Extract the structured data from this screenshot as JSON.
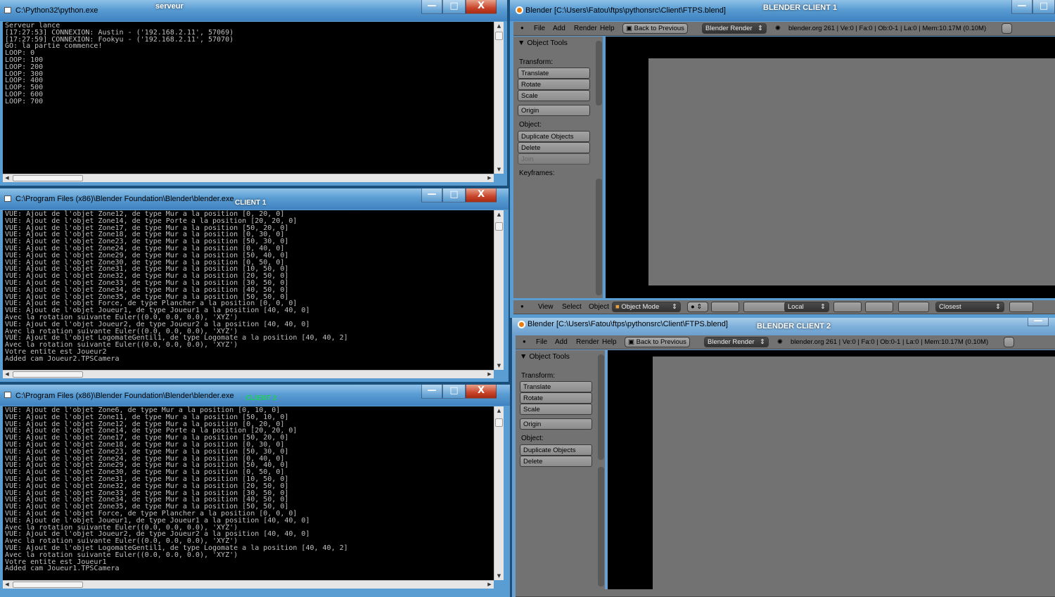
{
  "server_window": {
    "title": "C:\\Python32\\python.exe",
    "label": "serveur",
    "minimize": "—",
    "maximize": "□",
    "close": "X",
    "lines": [
      "Serveur lance",
      "[17:27:53] CONNEXION: Austin - ('192.168.2.11', 57069)",
      "[17:27:59] CONNEXION: Fookyu - ('192.168.2.11', 57070)",
      "GO: la partie commence!",
      "LOOP: 0",
      "LOOP: 100",
      "LOOP: 200",
      "LOOP: 300",
      "LOOP: 400",
      "LOOP: 500",
      "LOOP: 600",
      "LOOP: 700"
    ]
  },
  "client1_console": {
    "title": "C:\\Program Files (x86)\\Blender Foundation\\Blender\\blender.exe",
    "label": "CLIENT 1",
    "minimize": "—",
    "maximize": "□",
    "close": "X",
    "lines": [
      "VUE: Ajout de l'objet Zone12, de type Mur a la position [0, 20, 0]",
      "VUE: Ajout de l'objet Zone14, de type Porte a la position [20, 20, 0]",
      "VUE: Ajout de l'objet Zone17, de type Mur a la position [50, 20, 0]",
      "VUE: Ajout de l'objet Zone18, de type Mur a la position [0, 30, 0]",
      "VUE: Ajout de l'objet Zone23, de type Mur a la position [50, 30, 0]",
      "VUE: Ajout de l'objet Zone24, de type Mur a la position [0, 40, 0]",
      "VUE: Ajout de l'objet Zone29, de type Mur a la position [50, 40, 0]",
      "VUE: Ajout de l'objet Zone30, de type Mur a la position [0, 50, 0]",
      "VUE: Ajout de l'objet Zone31, de type Mur a la position [10, 50, 0]",
      "VUE: Ajout de l'objet Zone32, de type Mur a la position [20, 50, 0]",
      "VUE: Ajout de l'objet Zone33, de type Mur a la position [30, 50, 0]",
      "VUE: Ajout de l'objet Zone34, de type Mur a la position [40, 50, 0]",
      "VUE: Ajout de l'objet Zone35, de type Mur a la position [50, 50, 0]",
      "VUE: Ajout de l'objet Force, de type Plancher a la position [0, 0, 0]",
      "VUE: Ajout de l'objet Joueur1, de type Joueur1 a la position [40, 40, 0]",
      "Avec la rotation suivante Euler((0.0, 0.0, 0.0), 'XYZ')",
      "VUE: Ajout de l'objet Joueur2, de type Joueur2 a la position [40, 40, 0]",
      "Avec la rotation suivante Euler((0.0, 0.0, 0.0), 'XYZ')",
      "VUE: Ajout de l'objet LogomateGentil1, de type Logomate a la position [40, 40, 2]",
      "Avec la rotation suivante Euler((0.0, 0.0, 0.0), 'XYZ')",
      "Votre entite est Joueur2",
      "Added cam Joueur2.TPSCamera"
    ]
  },
  "client2_console": {
    "title": "C:\\Program Files (x86)\\Blender Foundation\\Blender\\blender.exe",
    "label": "CLIENT 2",
    "minimize": "—",
    "maximize": "□",
    "close": "X",
    "lines": [
      "VUE: Ajout de l'objet Zone6, de type Mur a la position [0, 10, 0]",
      "VUE: Ajout de l'objet Zone11, de type Mur a la position [50, 10, 0]",
      "VUE: Ajout de l'objet Zone12, de type Mur a la position [0, 20, 0]",
      "VUE: Ajout de l'objet Zone14, de type Porte a la position [20, 20, 0]",
      "VUE: Ajout de l'objet Zone17, de type Mur a la position [50, 20, 0]",
      "VUE: Ajout de l'objet Zone18, de type Mur a la position [0, 30, 0]",
      "VUE: Ajout de l'objet Zone23, de type Mur a la position [50, 30, 0]",
      "VUE: Ajout de l'objet Zone24, de type Mur a la position [0, 40, 0]",
      "VUE: Ajout de l'objet Zone29, de type Mur a la position [50, 40, 0]",
      "VUE: Ajout de l'objet Zone30, de type Mur a la position [0, 50, 0]",
      "VUE: Ajout de l'objet Zone31, de type Mur a la position [10, 50, 0]",
      "VUE: Ajout de l'objet Zone32, de type Mur a la position [20, 50, 0]",
      "VUE: Ajout de l'objet Zone33, de type Mur a la position [30, 50, 0]",
      "VUE: Ajout de l'objet Zone34, de type Mur a la position [40, 50, 0]",
      "VUE: Ajout de l'objet Zone35, de type Mur a la position [50, 50, 0]",
      "VUE: Ajout de l'objet Force, de type Plancher a la position [0, 0, 0]",
      "VUE: Ajout de l'objet Joueur1, de type Joueur1 a la position [40, 40, 0]",
      "Avec la rotation suivante Euler((0.0, 0.0, 0.0), 'XYZ')",
      "VUE: Ajout de l'objet Joueur2, de type Joueur2 a la position [40, 40, 0]",
      "Avec la rotation suivante Euler((0.0, 0.0, 0.0), 'XYZ')",
      "VUE: Ajout de l'objet LogomateGentil1, de type Logomate a la position [40, 40, 2]",
      "Avec la rotation suivante Euler((0.0, 0.0, 0.0), 'XYZ')",
      "Votre entite est Joueur1",
      "Added cam Joueur1.TPSCamera"
    ]
  },
  "blender1": {
    "title": "Blender [C:\\Users\\Fatou\\ftps\\pythonsrc\\Client\\FTPS.blend]",
    "label": "BLENDER CLIENT 1",
    "menu": [
      "File",
      "Add",
      "Render",
      "Help"
    ],
    "back_button": "Back to Previous",
    "engine": "Blender Render",
    "info": "blender.org 261 | Ve:0 | Fa:0 | Ob:0-1 | La:0 | Mem:10.17M (0.10M)",
    "panel_title": "Object Tools",
    "transform_label": "Transform:",
    "translate": "Translate",
    "rotate": "Rotate",
    "scale": "Scale",
    "origin": "Origin",
    "object_label": "Object:",
    "duplicate": "Duplicate Objects",
    "delete": "Delete",
    "join": "Join",
    "keyframes_label": "Keyframes:",
    "footer_menu": [
      "View",
      "Select",
      "Object"
    ],
    "mode": "Object Mode",
    "orientation": "Local",
    "snap": "Closest"
  },
  "blender2": {
    "title": "Blender [C:\\Users\\Fatou\\ftps\\pythonsrc\\Client\\FTPS.blend]",
    "label": "BLENDER CLIENT 2",
    "menu": [
      "File",
      "Add",
      "Render",
      "Help"
    ],
    "back_button": "Back to Previous",
    "engine": "Blender Render",
    "info": "blender.org 261 | Ve:0 | Fa:0 | Ob:0-1 | La:0 | Mem:10.17M (0.10M)",
    "panel_title": "Object Tools",
    "transform_label": "Transform:",
    "translate": "Translate",
    "rotate": "Rotate",
    "scale": "Scale",
    "origin": "Origin",
    "object_label": "Object:",
    "duplicate": "Duplicate Objects",
    "delete": "Delete"
  }
}
